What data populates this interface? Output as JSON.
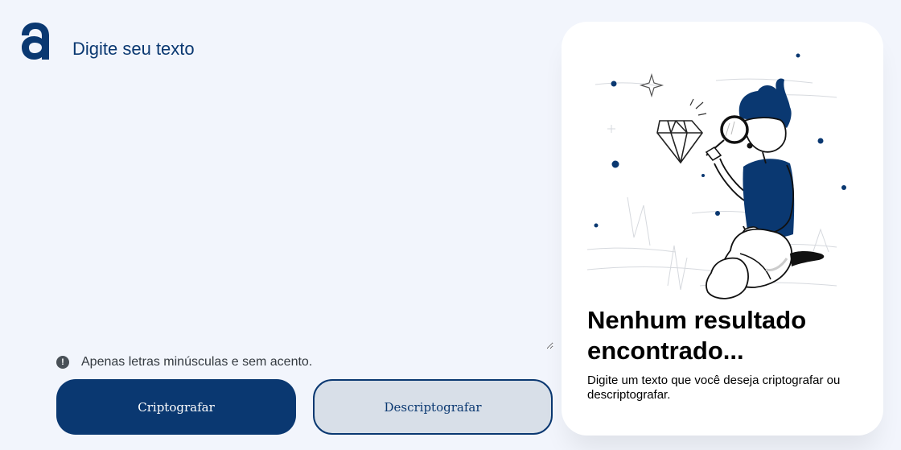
{
  "header": {
    "logo_icon": "alura-a-logo-icon",
    "brand_color": "#0a3871"
  },
  "input": {
    "placeholder": "Digite seu texto",
    "value": ""
  },
  "hint": {
    "icon": "exclamation-circle-icon",
    "text": "Apenas letras minúsculas e sem acento."
  },
  "buttons": {
    "encrypt_label": "Criptografar",
    "decrypt_label": "Descriptografar"
  },
  "result": {
    "illustration": "person-with-magnifying-glass-diamond-illustration",
    "title": "Nenhum resultado encontrado...",
    "description": "Digite um texto que você deseja criptografar ou descriptografar."
  },
  "colors": {
    "background": "#f2f5fc",
    "primary": "#0a3871",
    "secondary_button": "#d8dfe8",
    "panel": "#ffffff"
  }
}
